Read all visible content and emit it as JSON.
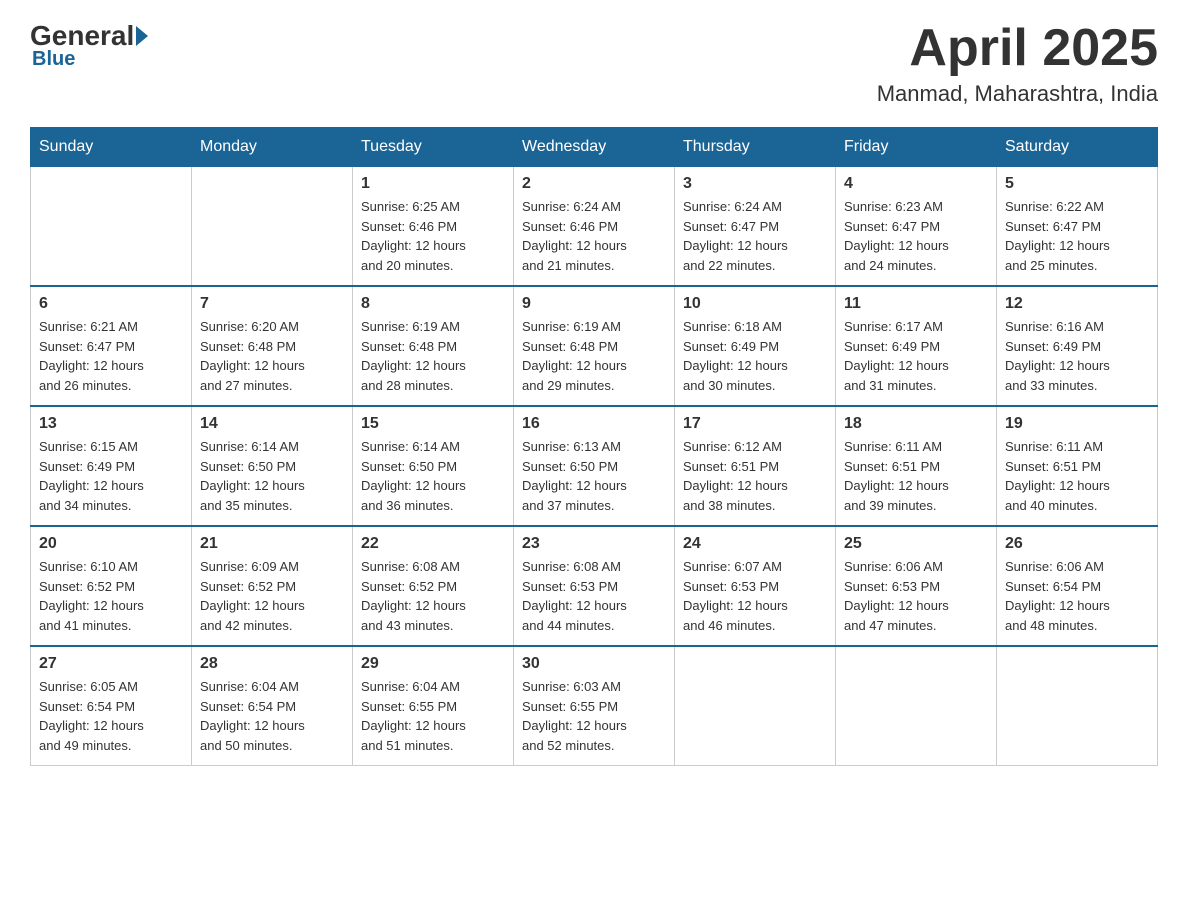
{
  "header": {
    "logo": {
      "general": "General",
      "blue": "Blue"
    },
    "title": "April 2025",
    "location": "Manmad, Maharashtra, India"
  },
  "calendar": {
    "days_of_week": [
      "Sunday",
      "Monday",
      "Tuesday",
      "Wednesday",
      "Thursday",
      "Friday",
      "Saturday"
    ],
    "weeks": [
      [
        {
          "day": "",
          "info": ""
        },
        {
          "day": "",
          "info": ""
        },
        {
          "day": "1",
          "info": "Sunrise: 6:25 AM\nSunset: 6:46 PM\nDaylight: 12 hours\nand 20 minutes."
        },
        {
          "day": "2",
          "info": "Sunrise: 6:24 AM\nSunset: 6:46 PM\nDaylight: 12 hours\nand 21 minutes."
        },
        {
          "day": "3",
          "info": "Sunrise: 6:24 AM\nSunset: 6:47 PM\nDaylight: 12 hours\nand 22 minutes."
        },
        {
          "day": "4",
          "info": "Sunrise: 6:23 AM\nSunset: 6:47 PM\nDaylight: 12 hours\nand 24 minutes."
        },
        {
          "day": "5",
          "info": "Sunrise: 6:22 AM\nSunset: 6:47 PM\nDaylight: 12 hours\nand 25 minutes."
        }
      ],
      [
        {
          "day": "6",
          "info": "Sunrise: 6:21 AM\nSunset: 6:47 PM\nDaylight: 12 hours\nand 26 minutes."
        },
        {
          "day": "7",
          "info": "Sunrise: 6:20 AM\nSunset: 6:48 PM\nDaylight: 12 hours\nand 27 minutes."
        },
        {
          "day": "8",
          "info": "Sunrise: 6:19 AM\nSunset: 6:48 PM\nDaylight: 12 hours\nand 28 minutes."
        },
        {
          "day": "9",
          "info": "Sunrise: 6:19 AM\nSunset: 6:48 PM\nDaylight: 12 hours\nand 29 minutes."
        },
        {
          "day": "10",
          "info": "Sunrise: 6:18 AM\nSunset: 6:49 PM\nDaylight: 12 hours\nand 30 minutes."
        },
        {
          "day": "11",
          "info": "Sunrise: 6:17 AM\nSunset: 6:49 PM\nDaylight: 12 hours\nand 31 minutes."
        },
        {
          "day": "12",
          "info": "Sunrise: 6:16 AM\nSunset: 6:49 PM\nDaylight: 12 hours\nand 33 minutes."
        }
      ],
      [
        {
          "day": "13",
          "info": "Sunrise: 6:15 AM\nSunset: 6:49 PM\nDaylight: 12 hours\nand 34 minutes."
        },
        {
          "day": "14",
          "info": "Sunrise: 6:14 AM\nSunset: 6:50 PM\nDaylight: 12 hours\nand 35 minutes."
        },
        {
          "day": "15",
          "info": "Sunrise: 6:14 AM\nSunset: 6:50 PM\nDaylight: 12 hours\nand 36 minutes."
        },
        {
          "day": "16",
          "info": "Sunrise: 6:13 AM\nSunset: 6:50 PM\nDaylight: 12 hours\nand 37 minutes."
        },
        {
          "day": "17",
          "info": "Sunrise: 6:12 AM\nSunset: 6:51 PM\nDaylight: 12 hours\nand 38 minutes."
        },
        {
          "day": "18",
          "info": "Sunrise: 6:11 AM\nSunset: 6:51 PM\nDaylight: 12 hours\nand 39 minutes."
        },
        {
          "day": "19",
          "info": "Sunrise: 6:11 AM\nSunset: 6:51 PM\nDaylight: 12 hours\nand 40 minutes."
        }
      ],
      [
        {
          "day": "20",
          "info": "Sunrise: 6:10 AM\nSunset: 6:52 PM\nDaylight: 12 hours\nand 41 minutes."
        },
        {
          "day": "21",
          "info": "Sunrise: 6:09 AM\nSunset: 6:52 PM\nDaylight: 12 hours\nand 42 minutes."
        },
        {
          "day": "22",
          "info": "Sunrise: 6:08 AM\nSunset: 6:52 PM\nDaylight: 12 hours\nand 43 minutes."
        },
        {
          "day": "23",
          "info": "Sunrise: 6:08 AM\nSunset: 6:53 PM\nDaylight: 12 hours\nand 44 minutes."
        },
        {
          "day": "24",
          "info": "Sunrise: 6:07 AM\nSunset: 6:53 PM\nDaylight: 12 hours\nand 46 minutes."
        },
        {
          "day": "25",
          "info": "Sunrise: 6:06 AM\nSunset: 6:53 PM\nDaylight: 12 hours\nand 47 minutes."
        },
        {
          "day": "26",
          "info": "Sunrise: 6:06 AM\nSunset: 6:54 PM\nDaylight: 12 hours\nand 48 minutes."
        }
      ],
      [
        {
          "day": "27",
          "info": "Sunrise: 6:05 AM\nSunset: 6:54 PM\nDaylight: 12 hours\nand 49 minutes."
        },
        {
          "day": "28",
          "info": "Sunrise: 6:04 AM\nSunset: 6:54 PM\nDaylight: 12 hours\nand 50 minutes."
        },
        {
          "day": "29",
          "info": "Sunrise: 6:04 AM\nSunset: 6:55 PM\nDaylight: 12 hours\nand 51 minutes."
        },
        {
          "day": "30",
          "info": "Sunrise: 6:03 AM\nSunset: 6:55 PM\nDaylight: 12 hours\nand 52 minutes."
        },
        {
          "day": "",
          "info": ""
        },
        {
          "day": "",
          "info": ""
        },
        {
          "day": "",
          "info": ""
        }
      ]
    ]
  }
}
